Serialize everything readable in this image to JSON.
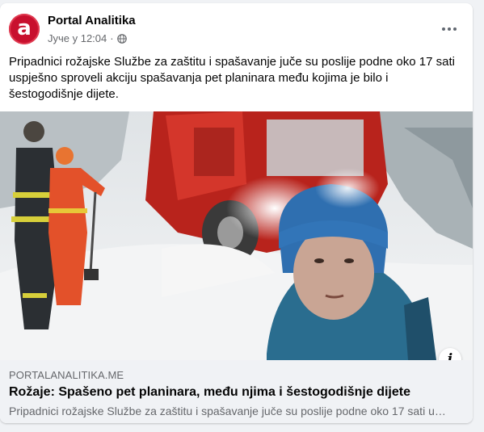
{
  "post": {
    "page_name": "Portal Analitika",
    "avatar_letter": "a",
    "timestamp": "Јуче у 12:04",
    "separator": "·",
    "privacy_icon": "globe-icon",
    "more_icon": "more-options-icon",
    "text": "Pripadnici rožajske Službe za zaštitu i spašavanje juče su poslije podne oko 17 sati uspješno sproveli akciju spašavanja pet planinara među kojima je bilo i šestogodišnje dijete."
  },
  "media": {
    "info_label": "i",
    "info_icon": "info-icon"
  },
  "link_preview": {
    "domain": "PORTALANALITIKA.ME",
    "title": "Rožaje: Spašeno pet planinara, među njima i šestogodišnje dijete",
    "description": "Pripadnici rožajske Službe za zaštitu i spašavanje juče su poslije podne oko 17 sati uspješno sproveli akciju spašavanja pet planinara među kojima je bilo i šestogodišnje dijete."
  },
  "colors": {
    "brand_red": "#c8102e",
    "text_primary": "#050505",
    "text_secondary": "#65676b",
    "preview_bg": "#f0f2f5"
  }
}
